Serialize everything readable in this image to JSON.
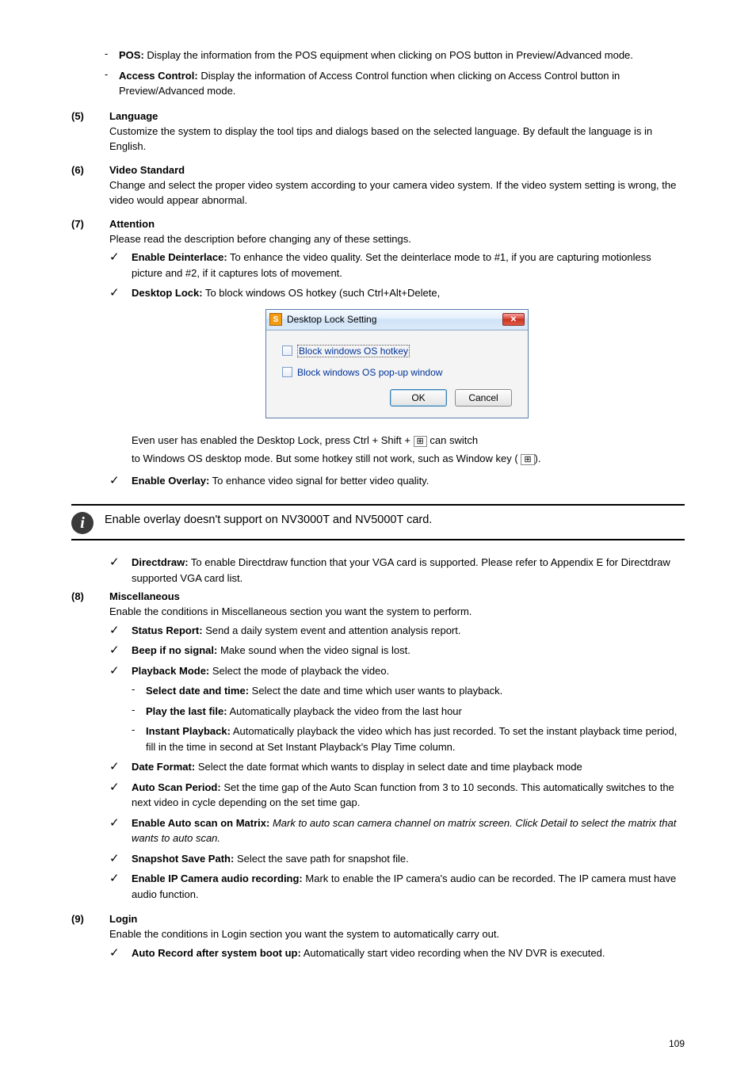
{
  "s1": {
    "dash": "-",
    "label": "POS:",
    "desc": "Display the information from the POS equipment when clicking on POS button in Preview/Advanced mode."
  },
  "s2": {
    "dash": "-",
    "label": "Access Control:",
    "desc": "Display the information of Access Control function when clicking on Access Control button in Preview/Advanced mode."
  },
  "item5": {
    "num": "(5)",
    "title": "Language",
    "desc": "Customize the system to display the tool tips and dialogs based on the selected language. By default the language is in English."
  },
  "item6": {
    "num": "(6)",
    "title": "Video Standard",
    "desc": "Change and select the proper video system according to your camera video system. If the video system setting is wrong, the video would appear abnormal."
  },
  "item7": {
    "num": "(7)",
    "title": "Attention",
    "desc": "Please read the description before changing any of these settings.",
    "check1": {
      "label": "Enable Deinterlace:",
      "desc": "To enhance the video quality. Set the deinterlace mode to #1, if you are capturing motionless picture and #2, if it captures lots of movement."
    },
    "check2": {
      "label": "Desktop Lock:",
      "desc": "To block windows OS hotkey (such Ctrl+Alt+Delete,"
    },
    "belowDialog": "Even user has enabled the Desktop Lock, press Ctrl + Shift +",
    "hotkeyRef": " can switch",
    "belowDialog2": "to Windows OS desktop mode. But some hotkey still not work, such as Window key (",
    "belowDialog2b": ")."
  },
  "dialog": {
    "title": "Desktop Lock Setting",
    "chk1": "Block windows OS hotkey",
    "chk2": "Block windows OS pop-up window",
    "ok": "OK",
    "cancel": "Cancel"
  },
  "item7b": {
    "check3": {
      "label": "Enable Overlay:",
      "desc": "To enhance video signal for better video quality."
    }
  },
  "callout": "Enable overlay doesn't support on NV3000T and NV5000T card.",
  "item7c": {
    "check4": {
      "label": "Directdraw:",
      "desc": "To enable Directdraw function that your VGA card is supported. Please refer to Appendix E for Directdraw supported VGA card list."
    }
  },
  "item8": {
    "num": "(8)",
    "title": "Miscellaneous",
    "desc": "Enable the conditions in Miscellaneous section you want the system to perform.",
    "c1": {
      "label": "Status Report:",
      "desc": "Send a daily system event and attention analysis report."
    },
    "c2": {
      "label": "Beep if no signal:",
      "desc": "Make sound when the video signal is lost."
    },
    "c3": {
      "label": "Playback Mode:",
      "desc": "Select the mode of playback the video."
    }
  },
  "item8sub": {
    "d1": {
      "label": "Select date and time:",
      "desc": "Select the date and time which user wants to playback."
    },
    "d2": {
      "label": "Play the last file:",
      "desc": "Automatically playback the video from the last hour"
    },
    "d3": {
      "label": "Instant Playback:",
      "desc": "Automatically playback the video which has just recorded. To set the instant playback time period, fill in the time in second at Set Instant Playback's Play Time column."
    }
  },
  "item8c4": {
    "label": "Date Format:",
    "desc": "Select the date format which wants to display in select date and time playback mode"
  },
  "item8c5": {
    "label": "Auto Scan Period:",
    "desc": "Set the time gap of the Auto Scan function from 3 to 10 seconds. This automatically switches to the next video in cycle depending on the set time gap."
  },
  "item8c6": {
    "label": "Enable Auto scan on Matrix:",
    "desc": "Mark to auto scan camera channel on matrix screen. Click Detail to select the matrix that wants to auto scan."
  },
  "item8c7": {
    "label": "Snapshot Save Path:",
    "desc": "Select the save path for snapshot file."
  },
  "item8c8": {
    "label": "Enable IP Camera audio recording:",
    "desc": "Mark to enable the IP camera's audio can be recorded. The IP camera must have audio function."
  },
  "item9": {
    "num": "(9)",
    "title": "Login",
    "desc": "Enable the conditions in Login section you want the system to automatically carry out."
  },
  "item9c": {
    "label": "Auto Record after system boot up:",
    "desc": "Automatically start video recording when the NV DVR is executed."
  },
  "footer": "109"
}
